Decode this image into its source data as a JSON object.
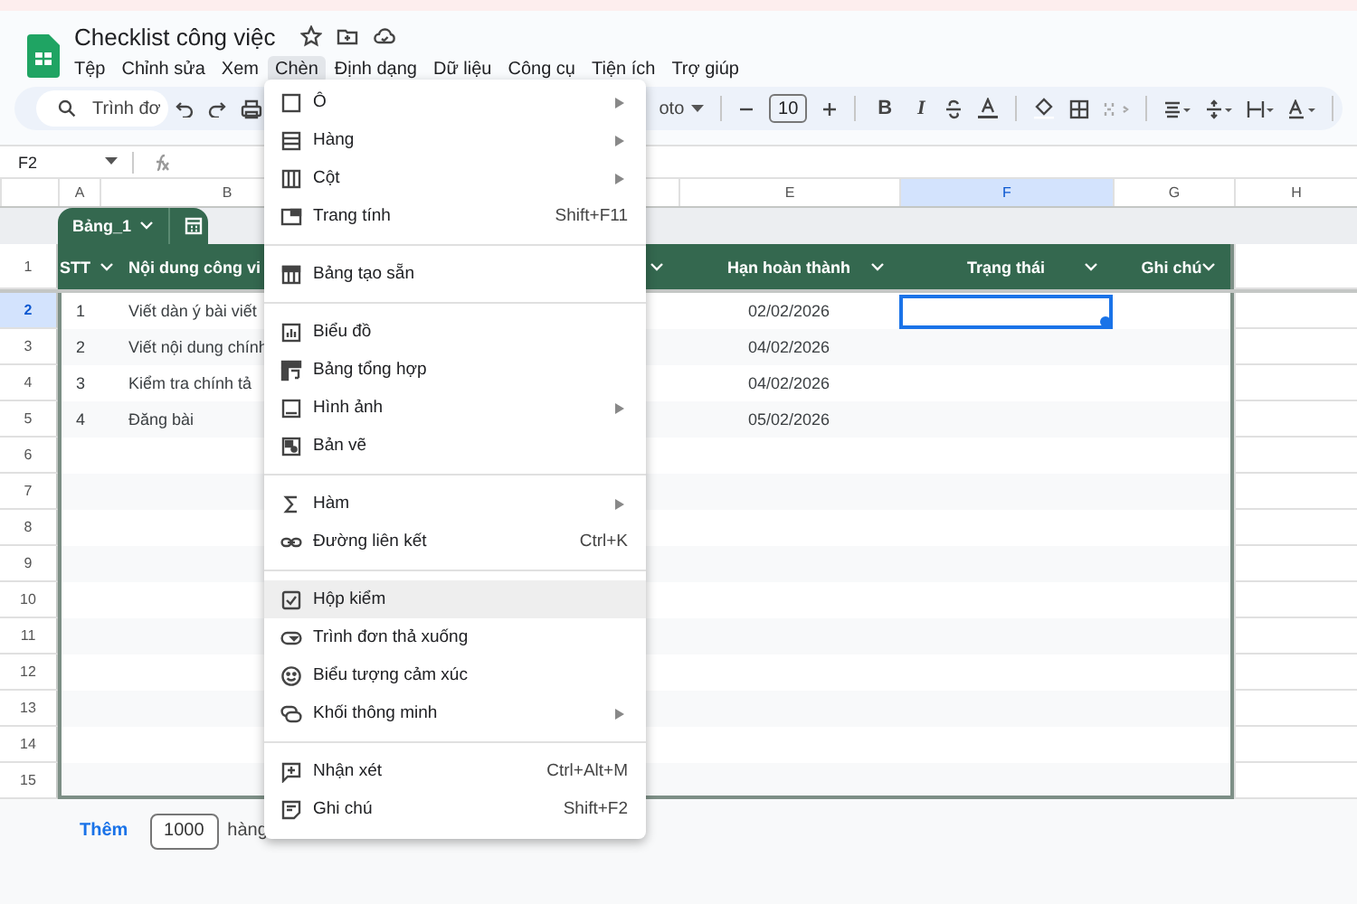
{
  "document": {
    "title": "Checklist công việc"
  },
  "menu_bar": [
    {
      "label": "Tệp",
      "selected": false
    },
    {
      "label": "Chỉnh sửa",
      "selected": false
    },
    {
      "label": "Xem",
      "selected": false
    },
    {
      "label": "Chèn",
      "selected": true
    },
    {
      "label": "Định dạng",
      "selected": false
    },
    {
      "label": "Dữ liệu",
      "selected": false
    },
    {
      "label": "Công cụ",
      "selected": false
    },
    {
      "label": "Tiện ích",
      "selected": false
    },
    {
      "label": "Trợ giúp",
      "selected": false
    }
  ],
  "toolbar": {
    "search_placeholder": "Trình đơ",
    "font": "oto",
    "font_size": "10",
    "bold": "B",
    "italic": "I"
  },
  "formula_bar": {
    "name_box": "F2"
  },
  "sheet": {
    "column_headers": [
      {
        "label": "A",
        "selected": false
      },
      {
        "label": "B",
        "selected": false
      },
      {
        "label": "E",
        "selected": false
      },
      {
        "label": "F",
        "selected": true
      },
      {
        "label": "G",
        "selected": false
      },
      {
        "label": "H",
        "selected": false
      }
    ],
    "row_headers": [
      {
        "label": "1",
        "selected": false
      },
      {
        "label": "2",
        "selected": true
      },
      {
        "label": "3",
        "selected": false
      },
      {
        "label": "4",
        "selected": false
      },
      {
        "label": "5",
        "selected": false
      },
      {
        "label": "6",
        "selected": false
      },
      {
        "label": "7",
        "selected": false
      },
      {
        "label": "8",
        "selected": false
      },
      {
        "label": "9",
        "selected": false
      },
      {
        "label": "10",
        "selected": false
      },
      {
        "label": "11",
        "selected": false
      },
      {
        "label": "12",
        "selected": false
      },
      {
        "label": "13",
        "selected": false
      },
      {
        "label": "14",
        "selected": false
      },
      {
        "label": "15",
        "selected": false
      }
    ],
    "table": {
      "name": "Bảng_1",
      "columns": [
        {
          "label": "STT",
          "filter": true
        },
        {
          "label": "Nội dung công vi"
        },
        {
          "filter": true
        },
        {
          "label": "Hạn hoàn thành",
          "filter": true
        },
        {
          "label": "Trạng thái",
          "filter": true
        },
        {
          "label": "Ghi chú",
          "filter": true
        }
      ],
      "rows": [
        {
          "cells": [
            {
              "text": "1"
            },
            {
              "text": "Viết dàn ý bài viết"
            },
            {
              "text": "02/02/2026"
            },
            {
              "selected": true
            }
          ]
        },
        {
          "cells": [
            {
              "text": "2"
            },
            {
              "text": "Viết nội dung chính"
            },
            {
              "text": "04/02/2026"
            },
            {
              "selected": false
            }
          ]
        },
        {
          "cells": [
            {
              "text": "3"
            },
            {
              "text": "Kiểm tra chính tả"
            },
            {
              "text": "04/02/2026"
            },
            {
              "selected": false
            }
          ]
        },
        {
          "cells": [
            {
              "text": "4"
            },
            {
              "text": "Đăng bài"
            },
            {
              "text": "05/02/2026"
            },
            {
              "selected": false
            }
          ]
        }
      ]
    }
  },
  "footer": {
    "add_button": "Thêm",
    "row_count": "1000",
    "unit": "hàng"
  },
  "insert_menu": {
    "sections": [
      [
        {
          "label": "Ô",
          "submenu": true,
          "selected": false
        },
        {
          "label": "Hàng",
          "submenu": true,
          "selected": false
        },
        {
          "label": "Cột",
          "submenu": true,
          "selected": false
        },
        {
          "label": "Trang tính",
          "shortcut": "Shift+F11",
          "submenu": false,
          "selected": false
        }
      ],
      [
        {
          "label": "Bảng tạo sẵn",
          "submenu": false,
          "selected": false
        }
      ],
      [
        {
          "label": "Biểu đồ",
          "submenu": false,
          "selected": false
        },
        {
          "label": "Bảng tổng hợp",
          "submenu": false,
          "selected": false
        },
        {
          "label": "Hình ảnh",
          "submenu": true,
          "selected": false
        },
        {
          "label": "Bản vẽ",
          "submenu": false,
          "selected": false
        }
      ],
      [
        {
          "label": "Hàm",
          "submenu": true,
          "selected": false
        },
        {
          "label": "Đường liên kết",
          "shortcut": "Ctrl+K",
          "submenu": false,
          "selected": false
        }
      ],
      [
        {
          "label": "Hộp kiểm",
          "submenu": false,
          "selected": true
        },
        {
          "label": "Trình đơn thả xuống",
          "submenu": false,
          "selected": false
        },
        {
          "label": "Biểu tượng cảm xúc",
          "submenu": false,
          "selected": false
        },
        {
          "label": "Khối thông minh",
          "submenu": true,
          "selected": false
        }
      ],
      [
        {
          "label": "Nhận xét",
          "shortcut": "Ctrl+Alt+M",
          "submenu": false,
          "selected": false
        },
        {
          "label": "Ghi chú",
          "shortcut": "Shift+F2",
          "submenu": false,
          "selected": false
        }
      ]
    ]
  }
}
